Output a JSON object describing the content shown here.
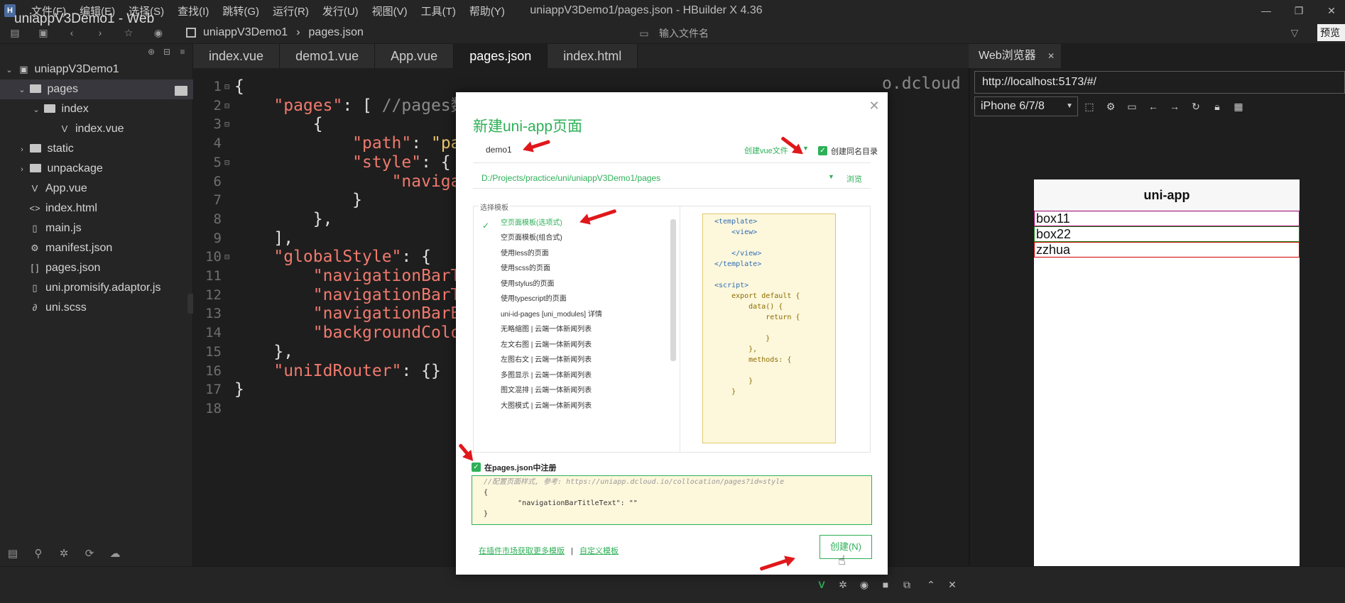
{
  "window": {
    "title": "uniappV3Demo1/pages.json - HBuilder X 4.36",
    "logo": "H",
    "min": "—",
    "max": "❐",
    "close": "✕"
  },
  "menu": [
    "文件(F)",
    "编辑(E)",
    "选择(S)",
    "查找(I)",
    "跳转(G)",
    "运行(R)",
    "发行(U)",
    "视图(V)",
    "工具(T)",
    "帮助(Y)"
  ],
  "toolbar": {
    "crumb_project": "uniappV3Demo1",
    "crumb_sep": "›",
    "crumb_file": "pages.json",
    "file_search_placeholder": "输入文件名",
    "preview": "预览"
  },
  "sidebar": {
    "items": [
      {
        "label": "uniappV3Demo1",
        "icon": "project-icon"
      },
      {
        "label": "pages",
        "icon": "folder-icon"
      },
      {
        "label": "index",
        "icon": "folder-icon"
      },
      {
        "label": "index.vue",
        "icon": "vue-file-icon"
      },
      {
        "label": "static",
        "icon": "folder-icon"
      },
      {
        "label": "unpackage",
        "icon": "folder-icon"
      },
      {
        "label": "App.vue",
        "icon": "vue-file-icon"
      },
      {
        "label": "index.html",
        "icon": "html-file-icon"
      },
      {
        "label": "main.js",
        "icon": "file-icon"
      },
      {
        "label": "manifest.json",
        "icon": "settings-file-icon"
      },
      {
        "label": "pages.json",
        "icon": "json-file-icon"
      },
      {
        "label": "uni.promisify.adaptor.js",
        "icon": "file-icon"
      },
      {
        "label": "uni.scss",
        "icon": "style-file-icon"
      }
    ]
  },
  "tabs": [
    "index.vue",
    "demo1.vue",
    "App.vue",
    "pages.json",
    "index.html"
  ],
  "editor": {
    "line_numbers": [
      "1",
      "2",
      "3",
      "4",
      "5",
      "6",
      "7",
      "8",
      "9",
      "10",
      "11",
      "12",
      "13",
      "14",
      "15",
      "16",
      "17",
      "18"
    ],
    "lines": [
      {
        "a": "{"
      },
      {
        "a": "    ",
        "k": "\"pages\"",
        "b": ": [ ",
        "c": "//pages数"
      },
      {
        "a": "        {"
      },
      {
        "a": "            ",
        "k": "\"path\"",
        "b": ": ",
        "s": "\"pa"
      },
      {
        "a": "            ",
        "k": "\"style\"",
        "b": ": {"
      },
      {
        "a": "                ",
        "k": "\"naviga"
      },
      {
        "a": "            }"
      },
      {
        "a": "        },"
      },
      {
        "a": "    ],"
      },
      {
        "a": "    ",
        "k": "\"globalStyle\"",
        "b": ": {"
      },
      {
        "a": "        ",
        "k": "\"navigationBarT"
      },
      {
        "a": "        ",
        "k": "\"navigationBarT"
      },
      {
        "a": "        ",
        "k": "\"navigationBarB"
      },
      {
        "a": "        ",
        "k": "\"backgroundColo"
      },
      {
        "a": "    },"
      },
      {
        "a": "    ",
        "k": "\"uniIdRouter\"",
        "b": ": {}"
      },
      {
        "a": "}"
      },
      {
        "a": ""
      }
    ],
    "right_fragment": "o.dcloud"
  },
  "browser": {
    "tab_label": "Web浏览器",
    "tab_close": "✕",
    "url": "http://localhost:5173/#/",
    "device": "iPhone 6/7/8",
    "nav_title": "uni-app",
    "boxes": [
      "box11",
      "box22",
      "zzhua"
    ]
  },
  "status": {
    "text": "uniappV3Demo1 - Web"
  },
  "dialog": {
    "close": "✕",
    "title": "新建uni-app页面",
    "page_name": "demo1",
    "vue_file_option": "创建vue文件",
    "create_dir_label": "创建同名目录",
    "path": "D:/Projects/practice/uni/uniappV3Demo1/pages",
    "browse": "浏览",
    "template_group_label": "选择模板",
    "templates": [
      "空页面模板(选项式)",
      "空页面模板(组合式)",
      "使用less的页面",
      "使用scss的页面",
      "使用stylus的页面",
      "使用typescript的页面",
      "uni-id-pages [uni_modules] 详情",
      "无略缩图 | 云端一体新闻列表",
      "左文右图 | 云端一体新闻列表",
      "左图右文 | 云端一体新闻列表",
      "多图显示 | 云端一体新闻列表",
      "图文混排 | 云端一体新闻列表",
      "大图模式 | 云端一体新闻列表"
    ],
    "preview_lines": [
      {
        "t": "<template>"
      },
      {
        "t": "    <view>"
      },
      {
        "t": ""
      },
      {
        "t": "    </view>"
      },
      {
        "t": "</template>"
      },
      {
        "t": ""
      },
      {
        "t": "<script>"
      },
      {
        "y": "    export default {"
      },
      {
        "y": "        data() {"
      },
      {
        "y": "            return {"
      },
      {
        "y": ""
      },
      {
        "y": "            }"
      },
      {
        "y": "        },"
      },
      {
        "y": "        methods: {"
      },
      {
        "y": ""
      },
      {
        "y": "        }"
      },
      {
        "y": "    }"
      }
    ],
    "register_label": "在pages.json中注册",
    "json_lines": [
      "//配置页面样式, 参考: https://uniapp.dcloud.io/collocation/pages?id=style",
      "{",
      "        \"navigationBarTitleText\": \"\"",
      "}"
    ],
    "link_market": "在插件市场获取更多模版",
    "link_sep": "|",
    "link_custom": "自定义模板",
    "create_button": "创建(N)"
  },
  "colors": {
    "accent_green": "#2db057",
    "arrow_red": "#e0171b",
    "editor_bg": "#1e1e1e"
  }
}
